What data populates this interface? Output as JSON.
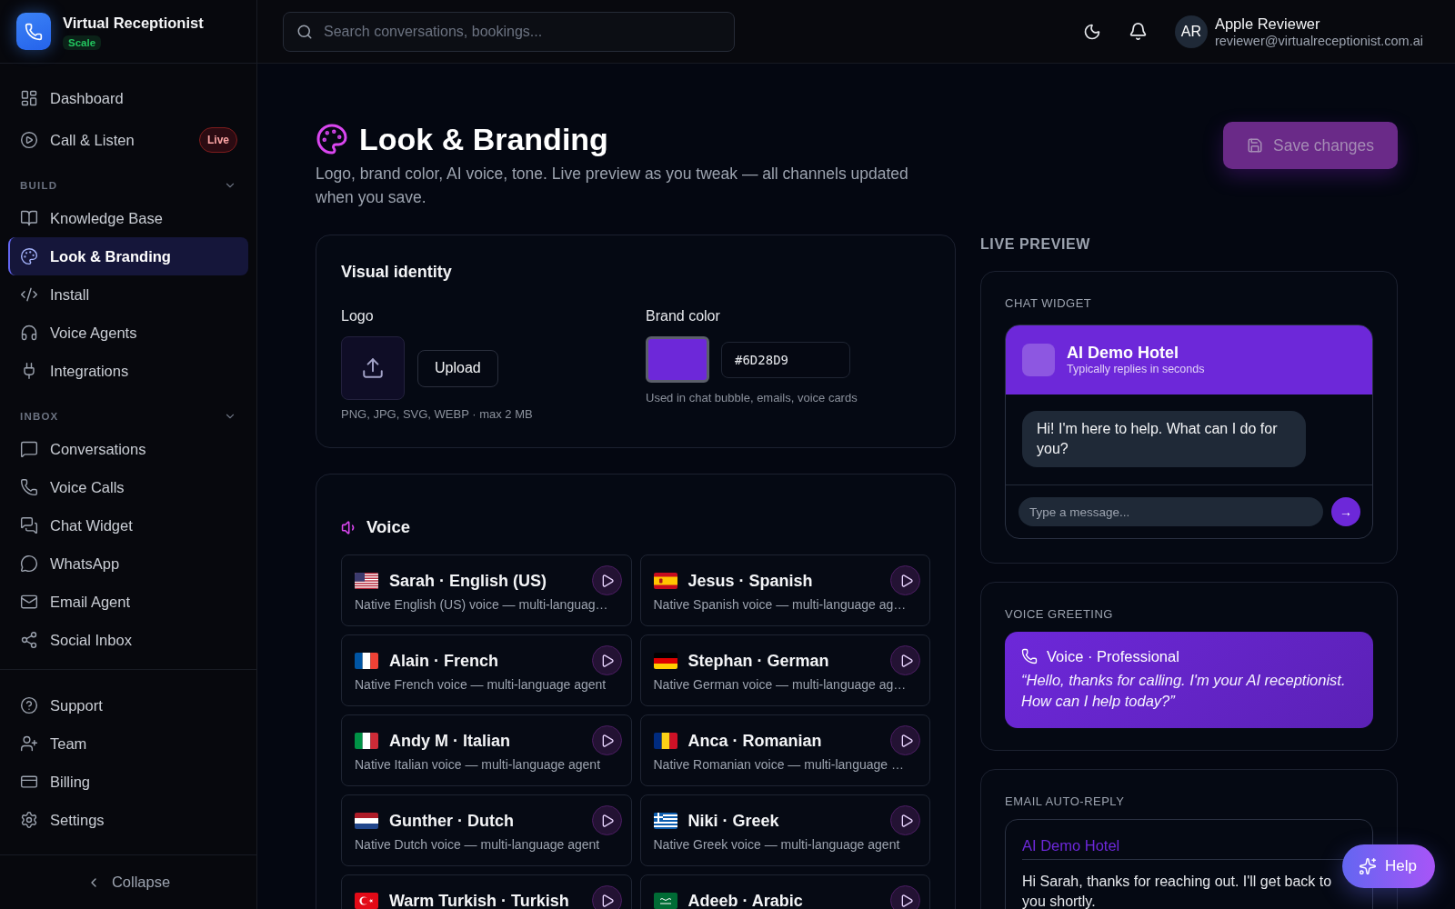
{
  "sidebar": {
    "brand": {
      "name": "Virtual Receptionist",
      "plan": "Scale"
    },
    "items": [
      {
        "label": "Dashboard",
        "selected": false
      },
      {
        "label": "Call & Listen",
        "selected": false,
        "badge": "Live"
      }
    ],
    "sections": [
      {
        "title": "BUILD",
        "expanded": true,
        "items": [
          {
            "label": "Knowledge Base",
            "selected": false
          },
          {
            "label": "Look & Branding",
            "selected": true
          },
          {
            "label": "Install",
            "selected": false
          },
          {
            "label": "Voice Agents",
            "selected": false
          },
          {
            "label": "Integrations",
            "selected": false
          }
        ]
      },
      {
        "title": "INBOX",
        "expanded": true,
        "items": [
          {
            "label": "Conversations",
            "selected": false
          },
          {
            "label": "Voice Calls",
            "selected": false
          },
          {
            "label": "Chat Widget",
            "selected": false
          },
          {
            "label": "WhatsApp",
            "selected": false
          },
          {
            "label": "Email Agent",
            "selected": false
          },
          {
            "label": "Social Inbox",
            "selected": false
          }
        ]
      }
    ],
    "footer_items": [
      {
        "label": "Support",
        "selected": false
      },
      {
        "label": "Team",
        "selected": false
      },
      {
        "label": "Billing",
        "selected": false
      },
      {
        "label": "Settings",
        "selected": false
      }
    ],
    "collapse": "Collapse"
  },
  "top_bar": {
    "search": {
      "placeholder": "Search conversations, bookings..."
    },
    "user": {
      "initials": "AR",
      "name": "Apple Reviewer",
      "email": "reviewer@virtualreceptionist.com.ai"
    }
  },
  "page": {
    "title": "Look & Branding",
    "subtitle": "Logo, brand color, AI voice, tone. Live preview as you tweak — all channels updated when you save.",
    "save_button": {
      "label": "Save changes",
      "disabled": true
    }
  },
  "visual_identity": {
    "title": "Visual identity",
    "logo": {
      "label": "Logo",
      "button": "Upload",
      "hint": "PNG, JPG, SVG, WEBP · max 2 MB"
    },
    "brand_color": {
      "label": "Brand color",
      "value": "#6D28D9",
      "hint": "Used in chat bubble, emails, voice cards"
    }
  },
  "voice": {
    "title": "Voice",
    "voices": [
      {
        "name": "Sarah · English (US)",
        "description": "Native English (US) voice — multi-languag…",
        "selected": false
      },
      {
        "name": "Jesus · Spanish",
        "description": "Native Spanish voice — multi-language ag…",
        "selected": false
      },
      {
        "name": "Alain · French",
        "description": "Native French voice — multi-language agent",
        "selected": false
      },
      {
        "name": "Stephan · German",
        "description": "Native German voice — multi-language ag…",
        "selected": false
      },
      {
        "name": "Andy M · Italian",
        "description": "Native Italian voice — multi-language agent",
        "selected": false
      },
      {
        "name": "Anca · Romanian",
        "description": "Native Romanian voice — multi-language …",
        "selected": false
      },
      {
        "name": "Gunther · Dutch",
        "description": "Native Dutch voice — multi-language agent",
        "selected": false
      },
      {
        "name": "Niki · Greek",
        "description": "Native Greek voice — multi-language agent",
        "selected": false
      },
      {
        "name": "Warm Turkish · Turkish",
        "selected": false
      },
      {
        "name": "Adeeb · Arabic",
        "selected": false
      }
    ]
  },
  "live_preview": {
    "title": "LIVE PREVIEW",
    "chat_widget": {
      "label": "CHAT WIDGET",
      "name": "AI Demo Hotel",
      "status": "Typically replies in seconds",
      "message": "Hi! I'm here to help. What can I do for you?",
      "input": {
        "placeholder": "Type a message..."
      },
      "send_label": "→"
    },
    "voice_greeting": {
      "label": "VOICE GREETING",
      "voice": "Voice · Professional",
      "quote": "“Hello, thanks for calling. I'm your AI receptionist. How can I help today?”"
    },
    "email_auto_reply": {
      "label": "EMAIL AUTO-REPLY",
      "sender": "AI Demo Hotel",
      "body": "Hi Sarah, thanks for reaching out. I'll get back to you shortly."
    }
  },
  "help_button": {
    "label": "Help"
  }
}
